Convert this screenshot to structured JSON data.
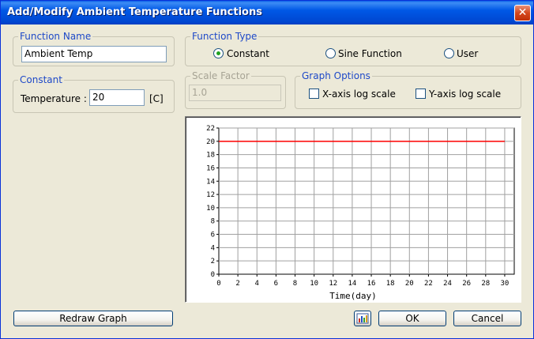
{
  "window": {
    "title": "Add/Modify Ambient Temperature Functions",
    "close_glyph": "✕"
  },
  "function_name": {
    "label": "Function Name",
    "value": "Ambient Temp"
  },
  "function_type": {
    "label": "Function Type",
    "options": [
      {
        "label": "Constant",
        "selected": true
      },
      {
        "label": "Sine Function",
        "selected": false
      },
      {
        "label": "User",
        "selected": false
      }
    ]
  },
  "constant": {
    "label": "Constant",
    "temperature_label": "Temperature :",
    "temperature_value": "20",
    "unit": "[C]"
  },
  "scale_factor": {
    "label": "Scale Factor",
    "value": "1.0"
  },
  "graph_options": {
    "label": "Graph Options",
    "x_log_label": "X-axis log scale",
    "x_log_checked": false,
    "y_log_label": "Y-axis log scale",
    "y_log_checked": false
  },
  "buttons": {
    "redraw": "Redraw Graph",
    "graph_icon": "chart-icon",
    "ok": "OK",
    "cancel": "Cancel"
  },
  "chart_data": {
    "type": "line",
    "xlabel": "Time(day)",
    "ylabel": "",
    "xlim": [
      0,
      31
    ],
    "ylim": [
      0,
      22
    ],
    "x_ticks": [
      0,
      2,
      4,
      6,
      8,
      10,
      12,
      14,
      16,
      18,
      20,
      22,
      24,
      26,
      28,
      30
    ],
    "y_ticks": [
      0,
      2,
      4,
      6,
      8,
      10,
      12,
      14,
      16,
      18,
      20,
      22
    ],
    "grid": true,
    "series": [
      {
        "color": "#ff0000",
        "x": [
          0,
          30
        ],
        "y": [
          20,
          20
        ]
      }
    ]
  }
}
